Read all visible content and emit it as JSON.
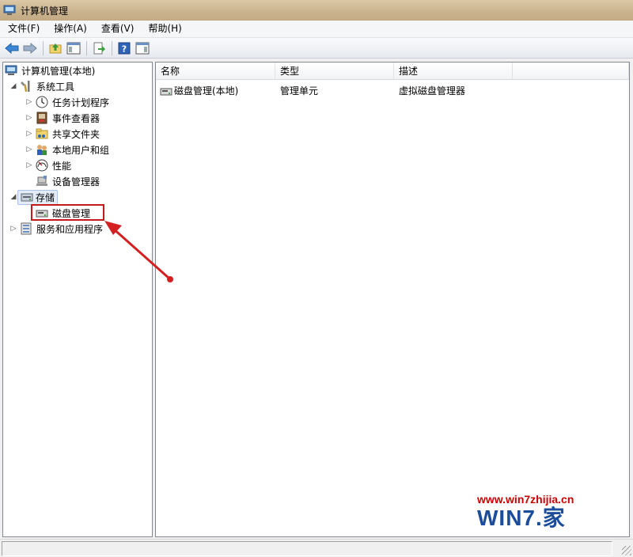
{
  "window": {
    "title": "计算机管理"
  },
  "menu": [
    "文件(F)",
    "操作(A)",
    "查看(V)",
    "帮助(H)"
  ],
  "toolbar": [
    "back-icon",
    "forward-icon",
    "up-folder-icon",
    "show-hide-tree-icon",
    "export-icon",
    "help-icon",
    "properties-icon"
  ],
  "tree": {
    "root": "计算机管理(本地)",
    "system_tools": "系统工具",
    "task_scheduler": "任务计划程序",
    "event_viewer": "事件查看器",
    "shared_folders": "共享文件夹",
    "local_users": "本地用户和组",
    "performance": "性能",
    "device_manager": "设备管理器",
    "storage": "存储",
    "disk_management": "磁盘管理",
    "services_apps": "服务和应用程序"
  },
  "list": {
    "columns": [
      "名称",
      "类型",
      "描述"
    ],
    "rows": [
      {
        "name": "磁盘管理(本地)",
        "type": "管理单元",
        "desc": "虚拟磁盘管理器"
      }
    ]
  },
  "watermark": {
    "url": "www.win7zhijia.cn",
    "logo": "WIN7.家"
  },
  "colors": {
    "annotation": "#d42020",
    "titlebar": "#c9b28d",
    "watermark_url": "#cc0000",
    "watermark_logo": "#1b4d9a"
  }
}
